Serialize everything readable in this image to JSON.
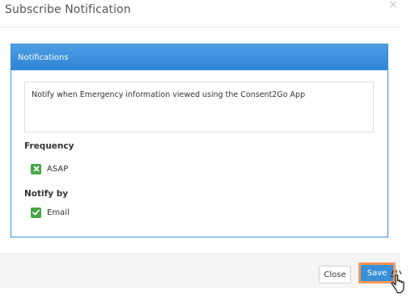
{
  "dialog": {
    "title": "Subscribe Notification",
    "close_glyph": "×"
  },
  "panel": {
    "heading": "Notifications",
    "message": "Notify when Emergency information viewed using the Consent2Go App"
  },
  "frequency": {
    "label": "Frequency",
    "option_label": "ASAP",
    "option_state": "checked-cross",
    "option_icon": "x-icon"
  },
  "notify_by": {
    "label": "Notify by",
    "option_label": "Email",
    "option_state": "checked",
    "option_icon": "checkmark-icon"
  },
  "footer": {
    "close_label": "Close",
    "save_label": "Save"
  },
  "colors": {
    "accent": "#3a8fd6",
    "check_green": "#47a447",
    "save_highlight": "#f0975a"
  },
  "cursor": {
    "icon": "hand-pointer-icon"
  }
}
